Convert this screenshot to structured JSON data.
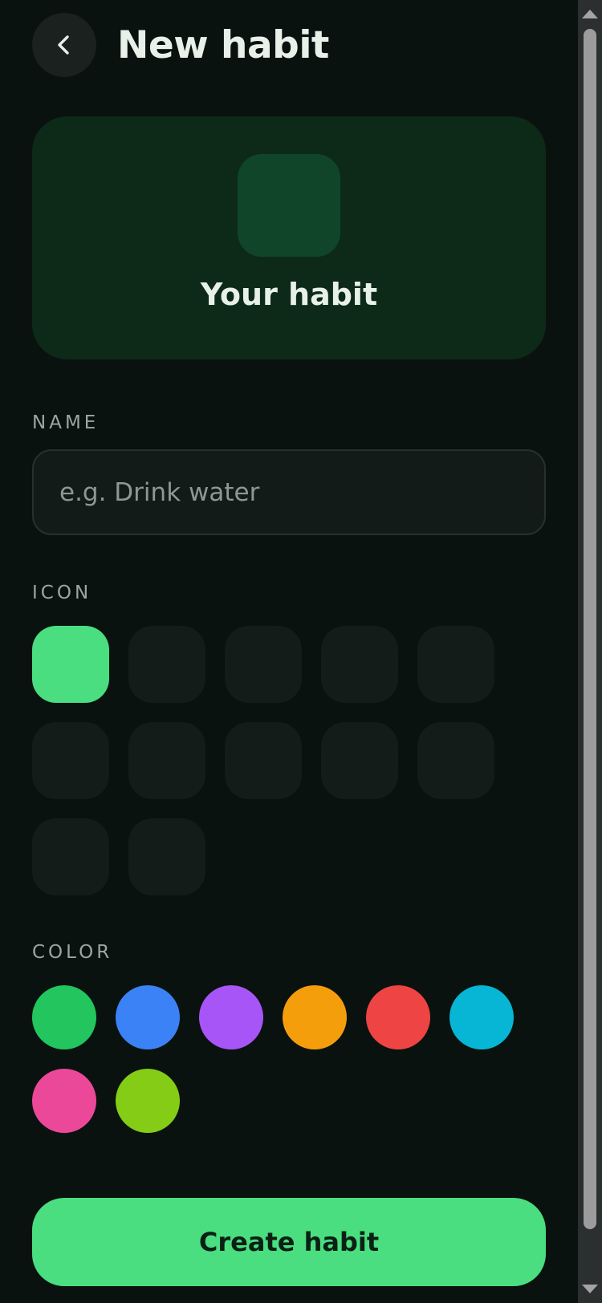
{
  "header": {
    "title": "New habit",
    "back_icon": "chevron-left-icon"
  },
  "preview": {
    "name": "Your habit",
    "icon_bg": "#10452a",
    "card_bg": "#0d2a19"
  },
  "name_section": {
    "label": "NAME",
    "input_value": "",
    "placeholder": "e.g. Drink water"
  },
  "icon_section": {
    "label": "ICON",
    "icon_count": 12,
    "selected_index": 0,
    "selected_color": "#4ade80"
  },
  "color_section": {
    "label": "COLOR",
    "colors": [
      "#22c55e",
      "#3b82f6",
      "#a855f7",
      "#f59e0b",
      "#ef4444",
      "#06b6d4",
      "#ec4899",
      "#84cc16"
    ]
  },
  "create_button": {
    "label": "Create habit",
    "bg": "#4ade80"
  }
}
